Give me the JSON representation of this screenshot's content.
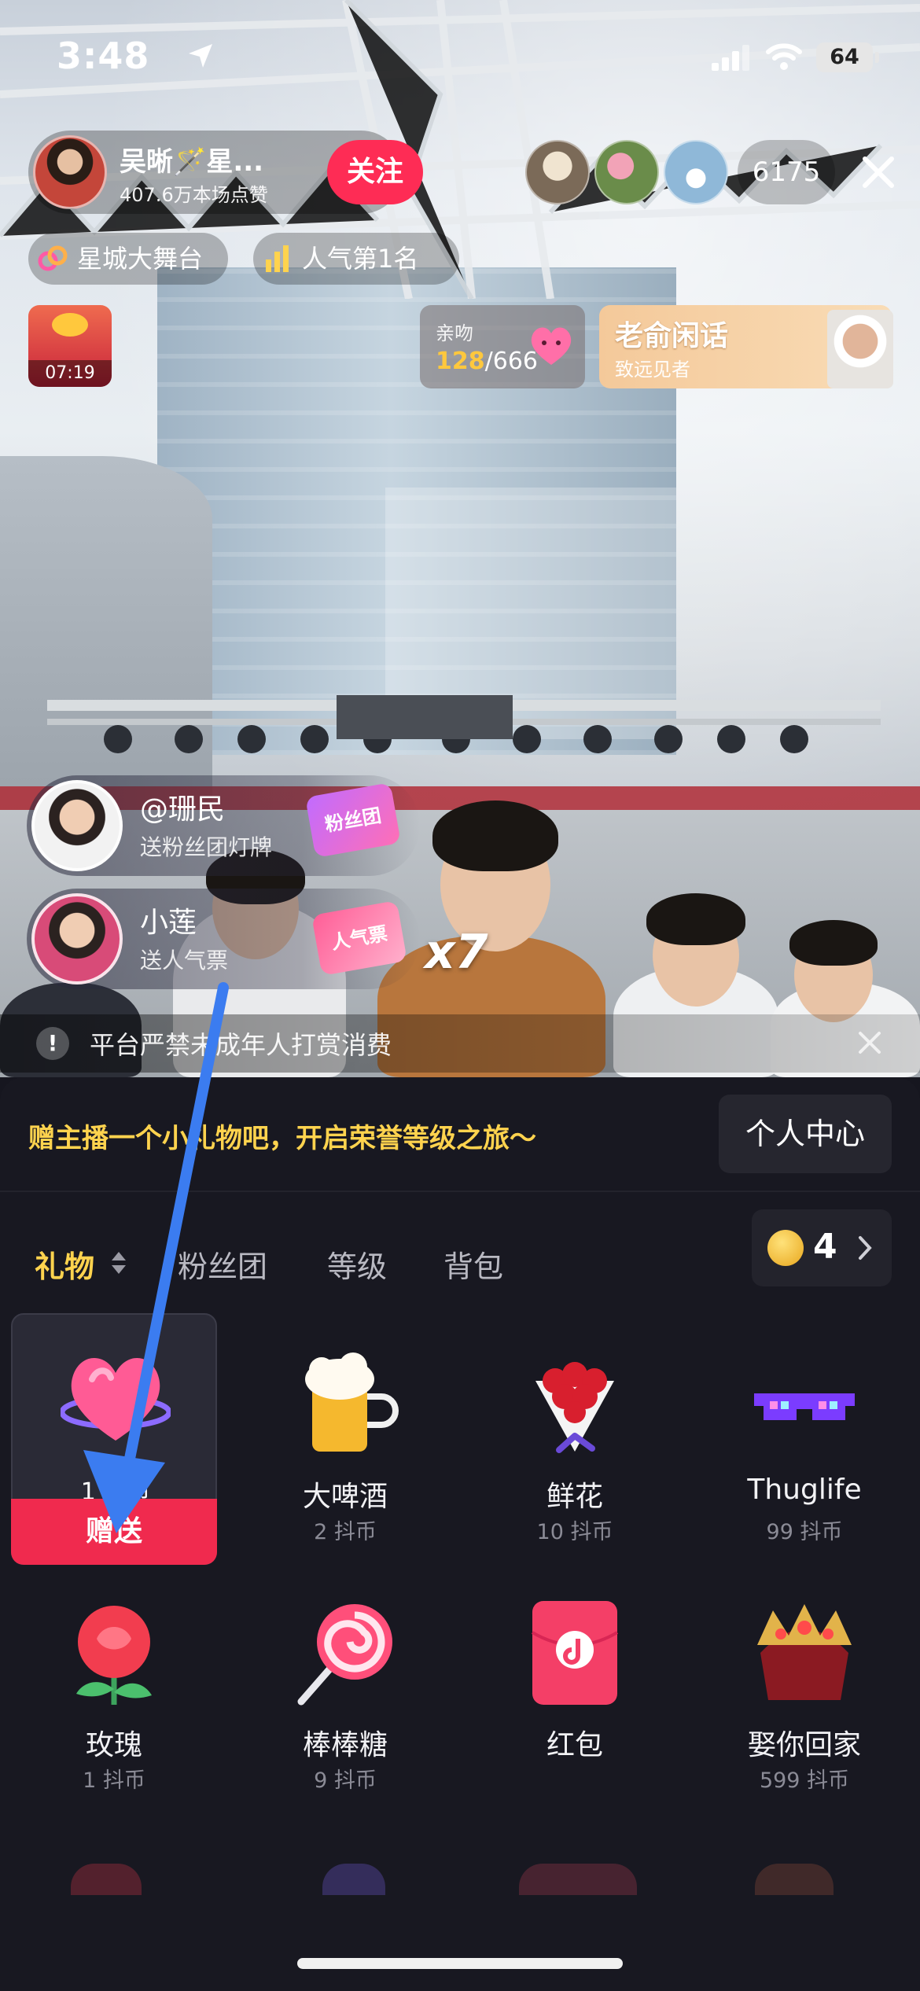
{
  "status_bar": {
    "time": "3:48",
    "battery": "64"
  },
  "host": {
    "name": "吴晰🪄星...",
    "likes": "407.6万本场点赞",
    "follow_label": "关注"
  },
  "viewers": {
    "count": "6175"
  },
  "tags": {
    "stage": "星城大舞台",
    "rank": "人气第1名"
  },
  "red_envelope": {
    "timer": "07:19"
  },
  "kiss_task": {
    "label": "亲吻",
    "current": "128",
    "total": "/666"
  },
  "promo_card": {
    "title": "老俞闲话",
    "subtitle": "致远见者"
  },
  "gift_feed": [
    {
      "name": "@珊民",
      "action": "送粉丝团灯牌",
      "gift_badge": "粉丝团"
    },
    {
      "name": "小莲",
      "action": "送人气票",
      "gift_badge": "人气票",
      "combo": "x7"
    }
  ],
  "warning": {
    "text": "平台严禁未成年人打赏消费"
  },
  "panel": {
    "promo": "赠主播一个小礼物吧，开启荣誉等级之旅～",
    "personal_center": "个人中心",
    "tabs": [
      "礼物",
      "粉丝团",
      "等级",
      "背包"
    ],
    "coin_balance": "4",
    "gifts": [
      {
        "name": "1 抖币",
        "price": "",
        "icon": "heart-icon",
        "selected": true,
        "action": "赠送"
      },
      {
        "name": "大啤酒",
        "price": "2 抖币",
        "icon": "beer-icon"
      },
      {
        "name": "鲜花",
        "price": "10 抖币",
        "icon": "bouquet-icon"
      },
      {
        "name": "Thuglife",
        "price": "99 抖币",
        "icon": "pixel-glasses-icon"
      },
      {
        "name": "玫瑰",
        "price": "1 抖币",
        "icon": "rose-icon"
      },
      {
        "name": "棒棒糖",
        "price": "9 抖币",
        "icon": "lollipop-icon"
      },
      {
        "name": "红包",
        "price": "",
        "icon": "red-envelope-icon"
      },
      {
        "name": "娶你回家",
        "price": "599 抖币",
        "icon": "crown-icon"
      }
    ]
  },
  "colors": {
    "accent": "#fe2c55",
    "gold": "#ffd34e",
    "panel": "#181821"
  }
}
